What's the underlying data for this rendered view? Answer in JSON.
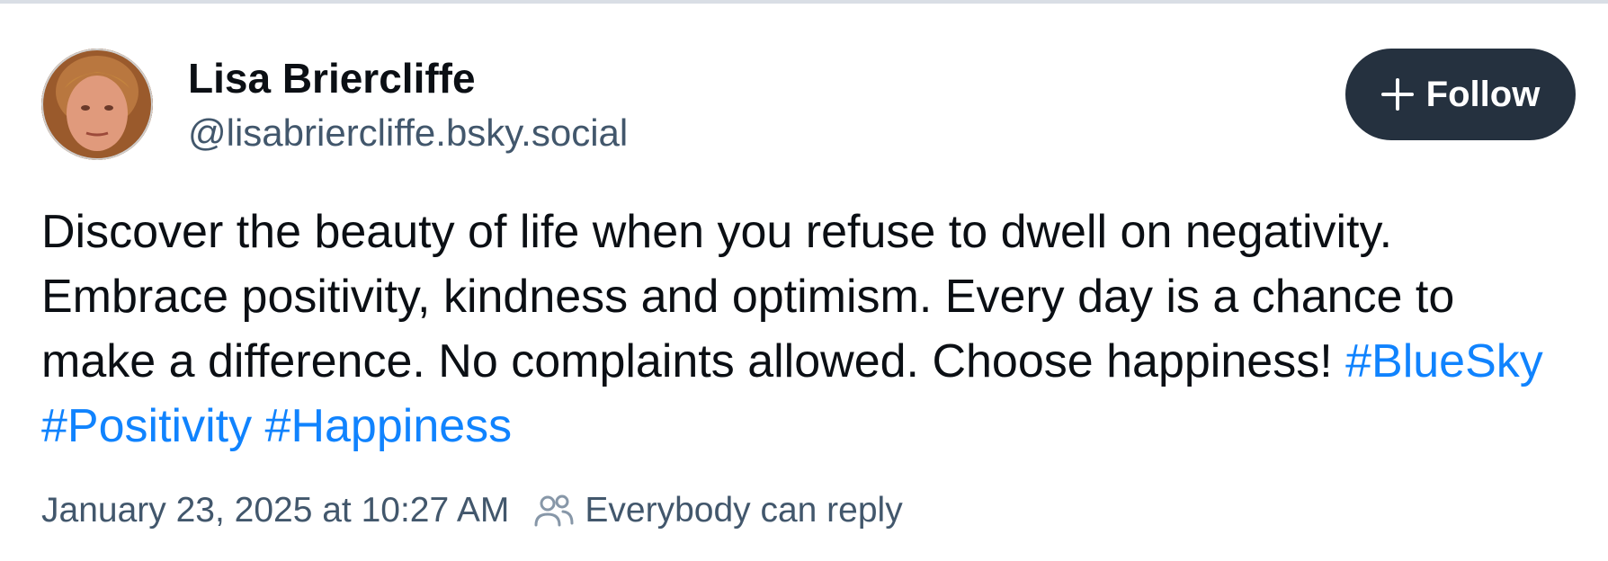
{
  "post": {
    "author": {
      "display_name": "Lisa Briercliffe",
      "handle": "@lisabriercliffe.bsky.social",
      "avatar_icon": "user-avatar-photo"
    },
    "follow_button": {
      "label": "Follow",
      "icon": "plus-icon",
      "background": "#25313f"
    },
    "text": {
      "body": "Discover the beauty of life when you refuse to dwell on negativity. Embrace positivity, kindness and optimism. Every day is a chance to make a difference. No complaints allowed. Choose happiness!",
      "hashtags": [
        "#BlueSky",
        "#Positivity",
        "#Happiness"
      ],
      "hashtag_color": "#1083fe"
    },
    "timestamp": "January 23, 2025 at 10:27 AM",
    "reply_setting": {
      "label": "Everybody can reply",
      "icon": "people-icon"
    }
  }
}
